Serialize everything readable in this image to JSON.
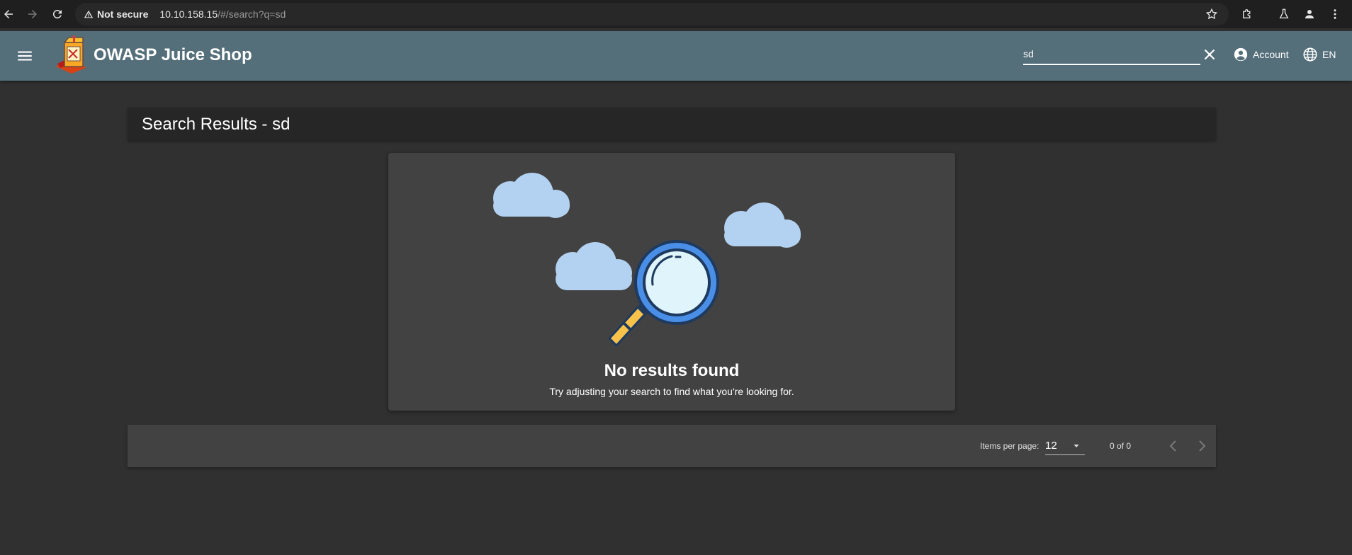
{
  "browser": {
    "security_label": "Not secure",
    "url_host": "10.10.158.15",
    "url_path": "/#/search?q=sd"
  },
  "toolbar": {
    "title": "OWASP Juice Shop",
    "search_value": "sd",
    "account_label": "Account",
    "language_label": "EN"
  },
  "results": {
    "title": "Search Results - sd"
  },
  "empty_state": {
    "title": "No results found",
    "subtitle": "Try adjusting your search to find what you're looking for."
  },
  "paginator": {
    "items_per_page_label": "Items per page:",
    "items_per_page_value": "12",
    "range_label": "0 of 0"
  },
  "colors": {
    "toolbar": "#546e7a",
    "background": "#303030",
    "card": "#424242",
    "cloud": "#b3d1f0",
    "lens_ring": "#4a8fe7"
  }
}
